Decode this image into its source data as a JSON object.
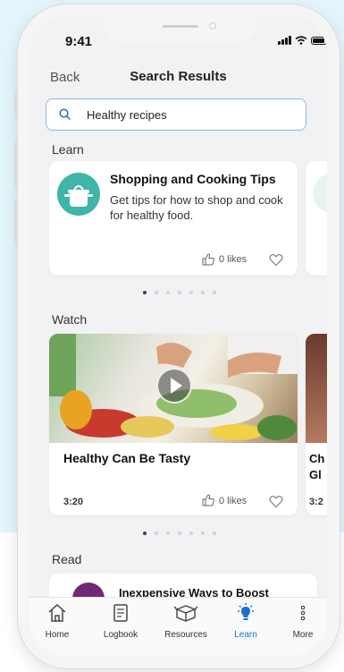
{
  "status_bar": {
    "time": "9:41"
  },
  "header": {
    "back_label": "Back",
    "title": "Search Results"
  },
  "search": {
    "value": "Healthy recipes",
    "icon": "search-icon"
  },
  "learn": {
    "section_label": "Learn",
    "card": {
      "title": "Shopping and Cooking Tips",
      "description": "Get tips for how to shop and cook for healthy food.",
      "likes": "0 likes",
      "icon": "cooking-pot-icon"
    },
    "pagination": {
      "count": 7,
      "active": 0
    }
  },
  "watch": {
    "section_label": "Watch",
    "card": {
      "title": "Healthy Can Be Tasty",
      "duration": "3:20",
      "likes": "0 likes"
    },
    "peek_card": {
      "title_line1": "Ch",
      "title_line2": "Gl",
      "duration": "3:2"
    },
    "pagination": {
      "count": 7,
      "active": 0
    }
  },
  "read": {
    "section_label": "Read",
    "card": {
      "title": "Inexpensive Ways to Boost"
    }
  },
  "tabs": [
    {
      "label": "Home",
      "icon": "home-icon",
      "active": false
    },
    {
      "label": "Logbook",
      "icon": "logbook-icon",
      "active": false
    },
    {
      "label": "Resources",
      "icon": "box-icon",
      "active": false
    },
    {
      "label": "Learn",
      "icon": "lightbulb-icon",
      "active": true
    },
    {
      "label": "More",
      "icon": "more-icon",
      "active": false
    }
  ],
  "colors": {
    "accent": "#1c6fd1",
    "teal": "#3fb5a7",
    "background": "#e3f4fa"
  }
}
